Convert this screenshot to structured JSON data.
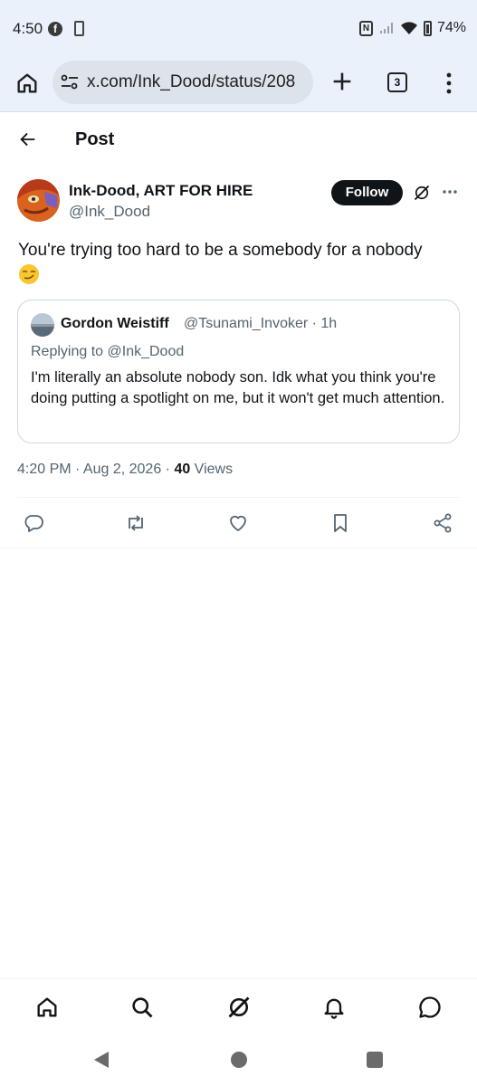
{
  "status_bar": {
    "time": "4:50",
    "battery": "74%",
    "icons": [
      "facebook-icon",
      "app-notification-icon",
      "nfc-icon",
      "signal-icon",
      "wifi-icon",
      "battery-icon"
    ]
  },
  "browser": {
    "url": "x.com/Ink_Dood/status/208",
    "tab_count": "3",
    "background": "#eaf1fb"
  },
  "header": {
    "title": "Post"
  },
  "post": {
    "author_name": "Ink-Dood, ART FOR HIRE",
    "author_handle": "@Ink_Dood",
    "follow_label": "Follow",
    "text": "You're trying too hard to be a somebody for a nobody",
    "emoji": "smirking-face-emoji",
    "timestamp": "4:20 PM · Aug 2, 2026 · ",
    "views_count": "40",
    "views_label": " Views"
  },
  "quote": {
    "name": "Gordon Weistiff",
    "handle": "@Tsunami_Invoker · 1h",
    "replying_prefix": "Replying to ",
    "replying_handle": "@Ink_Dood",
    "text": "I'm literally an absolute nobody son. Idk what you think you're doing putting a spotlight on me, but it won't get much attention."
  },
  "actions": [
    "reply-icon",
    "repost-icon",
    "like-icon",
    "bookmark-icon",
    "share-icon"
  ],
  "bottom_nav": [
    "home-icon",
    "search-icon",
    "grok-icon",
    "notifications-icon",
    "messages-icon"
  ],
  "colors": {
    "text_primary": "#0f1419",
    "text_secondary": "#536471",
    "border": "#cfd9de",
    "follow_bg": "#0f1419"
  }
}
